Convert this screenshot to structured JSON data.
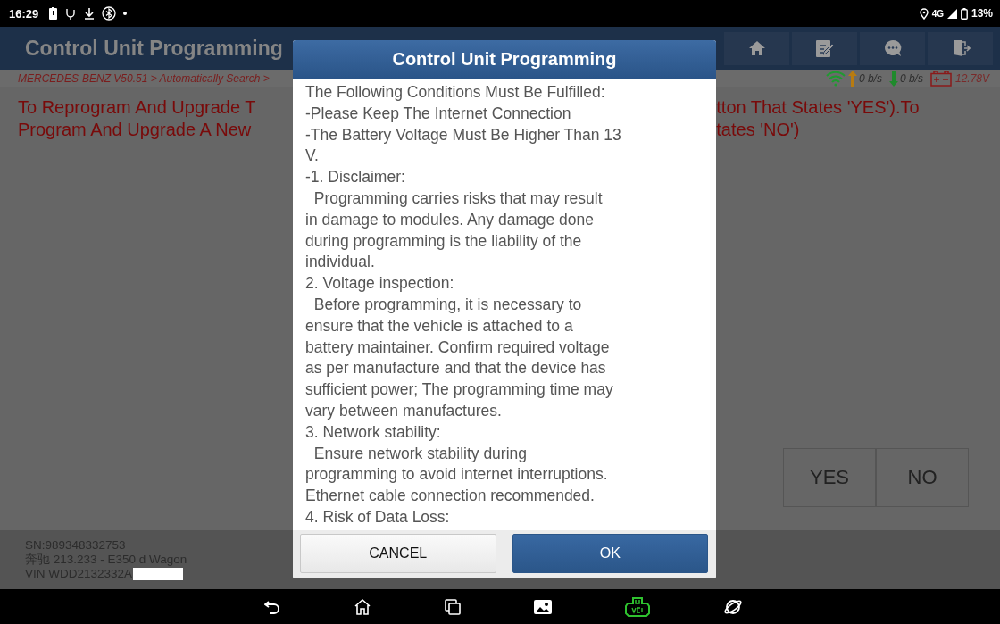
{
  "status_bar": {
    "time": "16:29",
    "network": "4G",
    "battery": "13%"
  },
  "app_bar": {
    "title": "Control Unit Programming"
  },
  "breadcrumb": "MERCEDES-BENZ V50.51 > Automatically Search >",
  "indicators": {
    "upload": "0 b/s",
    "download": "0 b/s",
    "voltage": "12.78V"
  },
  "message": {
    "left_lines": [
      "To Reprogram And Upgrade T",
      "Program And Upgrade A New"
    ],
    "right_lines": [
      "tton That States 'YES').To",
      "tates 'NO')"
    ]
  },
  "choice_buttons": [
    "YES",
    "NO"
  ],
  "vehicle_info": [
    "SN:989348332753",
    "奔驰 213.233 - E350 d Wagon",
    "VIN WDD2132332A"
  ],
  "dialog": {
    "title": "Control Unit Programming",
    "lines": [
      "The Following Conditions Must Be Fulfilled:",
      "-Please Keep The Internet Connection",
      "-The Battery Voltage Must Be Higher Than 13",
      "V.",
      "-1. Disclaimer:",
      "  Programming carries risks that may result",
      "in damage to modules. Any damage done",
      "during programming is the liability of the",
      "individual.",
      "2. Voltage inspection:",
      "  Before programming, it is necessary to",
      "ensure that the vehicle is attached to a",
      "battery maintainer. Confirm required voltage",
      "as per manufacture and that the device has",
      "sufficient power; The programming time may",
      "vary between manufactures.",
      "3. Network stability:",
      "  Ensure network stability during",
      "programming to avoid internet interruptions.",
      "Ethernet cable connection recommended.",
      "4. Risk of Data Loss:"
    ],
    "buttons": [
      {
        "label": "CANCEL",
        "kind": "secondary"
      },
      {
        "label": "OK",
        "kind": "primary"
      }
    ]
  }
}
